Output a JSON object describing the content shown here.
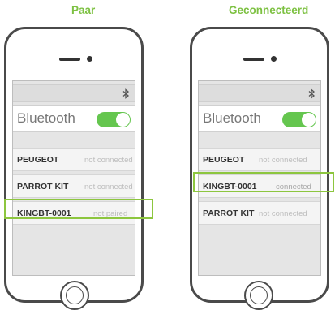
{
  "left_panel": {
    "title": "Paar",
    "setting_label": "Bluetooth",
    "devices": [
      {
        "name": "PEUGEOT",
        "status": "not connected"
      },
      {
        "name": "PARROT KIT",
        "status": "not connected"
      },
      {
        "name": "KINGBT-0001",
        "status": "not paired"
      }
    ],
    "highlighted_device": "KINGBT-0001"
  },
  "right_panel": {
    "title": "Geconnecteerd",
    "setting_label": "Bluetooth",
    "devices": [
      {
        "name": "PEUGEOT",
        "status": "not connected"
      },
      {
        "name": "KINGBT-0001",
        "status": "connected"
      },
      {
        "name": "PARROT KIT",
        "status": "not connected"
      }
    ],
    "highlighted_device": "KINGBT-0001"
  },
  "colors": {
    "title_green": "#7dc142",
    "toggle_green": "#65c64f",
    "highlight_green": "#8dc63f",
    "phone_frame": "#4a4a4a"
  },
  "icons": [
    "bluetooth-icon",
    "home-button-icon",
    "speaker-icon",
    "camera-icon"
  ]
}
